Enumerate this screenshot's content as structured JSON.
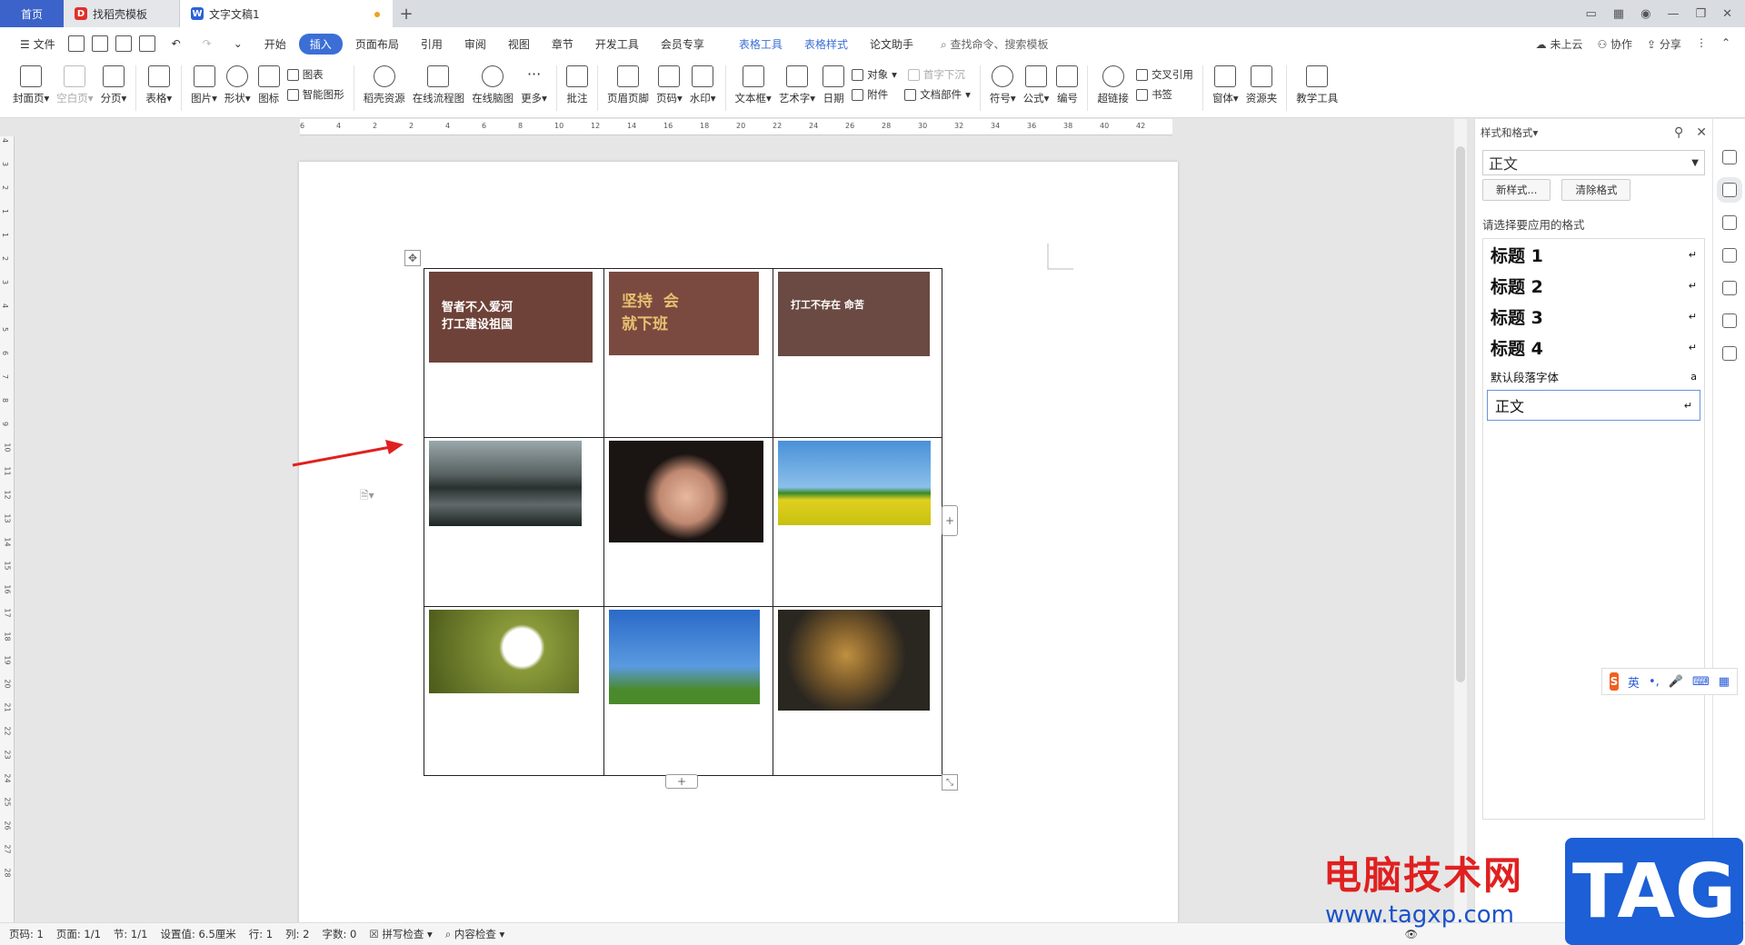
{
  "tabs": [
    {
      "label": "首页"
    },
    {
      "label": "找稻壳模板"
    },
    {
      "label": "文字文稿1"
    }
  ],
  "menu": {
    "file": "文件",
    "items": [
      "开始",
      "插入",
      "页面布局",
      "引用",
      "审阅",
      "视图",
      "章节",
      "开发工具",
      "会员专享"
    ],
    "active_index": 1,
    "context_tabs": [
      "表格工具",
      "表格样式"
    ],
    "paper_helper": "论文助手",
    "search": "查找命令、搜索模板",
    "right": [
      "未上云",
      "协作",
      "分享"
    ]
  },
  "ribbon": {
    "buttons": [
      {
        "label": "封面页",
        "dropdown": true
      },
      {
        "label": "空白页",
        "dropdown": true,
        "disabled": true
      },
      {
        "label": "分页",
        "dropdown": true
      },
      {
        "label": "表格",
        "dropdown": true
      },
      {
        "label": "图片",
        "dropdown": true
      },
      {
        "label": "形状",
        "dropdown": true
      },
      {
        "label": "图标"
      }
    ],
    "chart": "图表",
    "smart_graphic": "智能图形",
    "buttons2": [
      {
        "label": "稻壳资源"
      },
      {
        "label": "在线流程图"
      },
      {
        "label": "在线脑图"
      },
      {
        "label": "更多",
        "dropdown": true
      },
      {
        "label": "批注"
      },
      {
        "label": "页眉页脚"
      },
      {
        "label": "页码",
        "dropdown": true
      },
      {
        "label": "水印",
        "dropdown": true
      },
      {
        "label": "文本框",
        "dropdown": true
      },
      {
        "label": "艺术字",
        "dropdown": true
      },
      {
        "label": "日期"
      }
    ],
    "object": "对象",
    "dropcap": "首字下沉",
    "attachment": "附件",
    "doc_parts": "文档部件",
    "buttons3": [
      {
        "label": "符号",
        "dropdown": true
      },
      {
        "label": "公式",
        "dropdown": true
      },
      {
        "label": "编号"
      },
      {
        "label": "超链接"
      }
    ],
    "crossref": "交叉引用",
    "bookmark": "书签",
    "buttons4": [
      {
        "label": "窗体",
        "dropdown": true
      },
      {
        "label": "资源夹"
      },
      {
        "label": "教学工具"
      }
    ]
  },
  "ruler_ticks": [
    "6",
    "4",
    "2",
    "2",
    "4",
    "6",
    "8",
    "10",
    "12",
    "14",
    "16",
    "18",
    "20",
    "22",
    "24",
    "26",
    "28",
    "30",
    "32",
    "34",
    "36",
    "38",
    "40",
    "42"
  ],
  "vruler_ticks": [
    "4",
    "3",
    "2",
    "1",
    "1",
    "2",
    "3",
    "4",
    "5",
    "6",
    "7",
    "8",
    "9",
    "10",
    "11",
    "12",
    "13",
    "14",
    "15",
    "16",
    "17",
    "18",
    "19",
    "20",
    "21",
    "22",
    "23",
    "24",
    "25",
    "26",
    "27",
    "28"
  ],
  "table": {
    "cells": [
      {
        "desc": "poster",
        "caption": "智者不入爱河\n打工建设祖国",
        "color": "#6e4238"
      },
      {
        "desc": "poster",
        "caption": "坚持  会\n就下班",
        "color": "#7a4a40"
      },
      {
        "desc": "poster",
        "caption": "打工不存在 命苦",
        "color": "#6a4a42"
      },
      {
        "desc": "lake",
        "caption": "",
        "color": "#3a4446"
      },
      {
        "desc": "portrait",
        "caption": "",
        "color": "#2a2220"
      },
      {
        "desc": "meadow",
        "caption": "",
        "color": "#5aa0d8"
      },
      {
        "desc": "daisy",
        "caption": "",
        "color": "#6a7a2a"
      },
      {
        "desc": "husky",
        "caption": "",
        "color": "#3a7acc"
      },
      {
        "desc": "leaves",
        "caption": "",
        "color": "#3a3228"
      }
    ]
  },
  "panel": {
    "title": "样式和格式",
    "current_style": "正文",
    "new_style": "新样式...",
    "clear_format": "清除格式",
    "prompt": "请选择要应用的格式",
    "styles": [
      {
        "label": "标题  1",
        "mark": "↵"
      },
      {
        "label": "标题  2",
        "mark": "↵"
      },
      {
        "label": "标题  3",
        "mark": "↵"
      },
      {
        "label": "标题  4",
        "mark": "↵"
      },
      {
        "label": "默认段落字体",
        "mark": "a"
      },
      {
        "label": "正文",
        "mark": "↵"
      }
    ]
  },
  "ime": {
    "lang": "英",
    "punct": "•,"
  },
  "status": {
    "page_num": "页码: 1",
    "pages": "页面: 1/1",
    "section": "节: 1/1",
    "setting": "设置值: 6.5厘米",
    "row": "行: 1",
    "col": "列: 2",
    "words": "字数: 0",
    "spell": "拼写检查",
    "content": "内容检查"
  },
  "watermark": {
    "site": "电脑技术网",
    "url": "www.tagxp.com",
    "tag": "TAG"
  }
}
